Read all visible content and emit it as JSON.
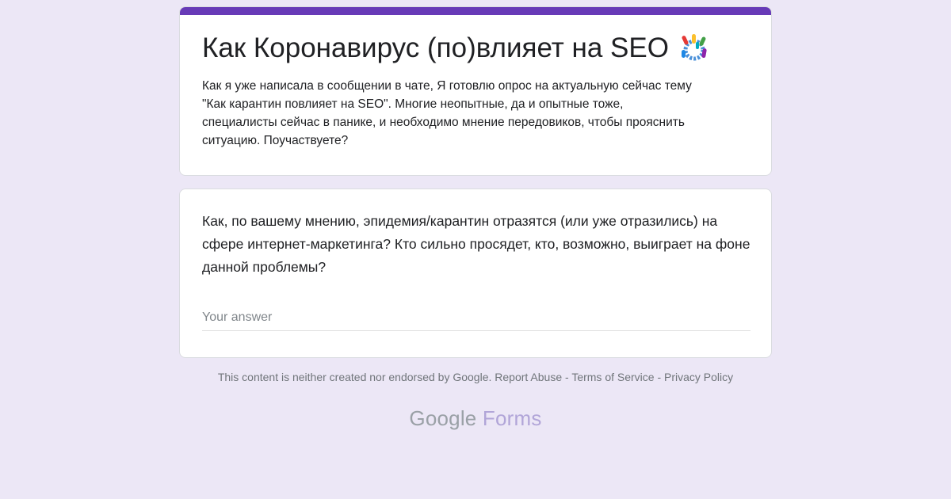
{
  "form": {
    "title": "Как Коронавирус (по)влияет на SEO",
    "title_icon": "coronavirus-icon",
    "description": "Как я уже написала в сообщении в чате, Я готовлю опрос на актуальную сейчас тему\n\"Как карантин повлияет на SEO\". Многие неопытные, да и опытные тоже,\nспециалисты сейчас в панике, и необходимо мнение передовиков, чтобы прояснить\nситуацию. Поучаствуете?",
    "accent_color": "#673ab7"
  },
  "question": {
    "text": "Как, по вашему мнению, эпидемия/карантин отразятся (или уже отразились) на сфере интернет-маркетинга? Кто сильно просядет, кто, возможно, выиграет на фоне данной проблемы?",
    "answer_placeholder": "Your answer",
    "answer_value": ""
  },
  "footer": {
    "disclaimer": "This content is neither created nor endorsed by Google.",
    "report_abuse": "Report Abuse",
    "separator": "-",
    "terms": "Terms of Service",
    "privacy": "Privacy Policy"
  },
  "brand": {
    "google": "Google",
    "forms": "Forms"
  },
  "colors": {
    "background": "#ece7f6",
    "card": "#ffffff",
    "footer_text": "#70757a"
  }
}
